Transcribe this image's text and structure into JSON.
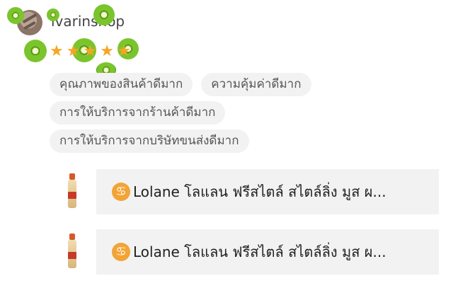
{
  "review": {
    "username": "ivarinshop",
    "rating": 5,
    "stars": [
      "★",
      "★",
      "★",
      "★",
      "★"
    ]
  },
  "tags": {
    "row1": [
      "คุณภาพของสินค้าดีมาก",
      "ความคุ้มค่าดีมาก"
    ],
    "row2": [
      "การให้บริการจากร้านค้าดีมาก"
    ],
    "row3": [
      "การให้บริการจากบริษัทขนส่งดีมาก"
    ]
  },
  "products": [
    {
      "icon": "♋",
      "title": "Lolane โลแลน ฟรีสไตล์ สไตล์ลิ่ง มูส ผ..."
    },
    {
      "icon": "♋",
      "title": "Lolane โลแลน ฟรีสไตล์ สไตล์ลิ่ง มูส ผ..."
    }
  ],
  "colors": {
    "star": "#f5a623",
    "tag_bg": "#f2f2f2",
    "product_bg": "#f2f2f2",
    "kiwi_green": "#7ac52c"
  },
  "icons": [
    "avatar",
    "kiwi-sticker-icon",
    "star-icon",
    "cancer-zodiac-icon",
    "product-thumbnail"
  ]
}
